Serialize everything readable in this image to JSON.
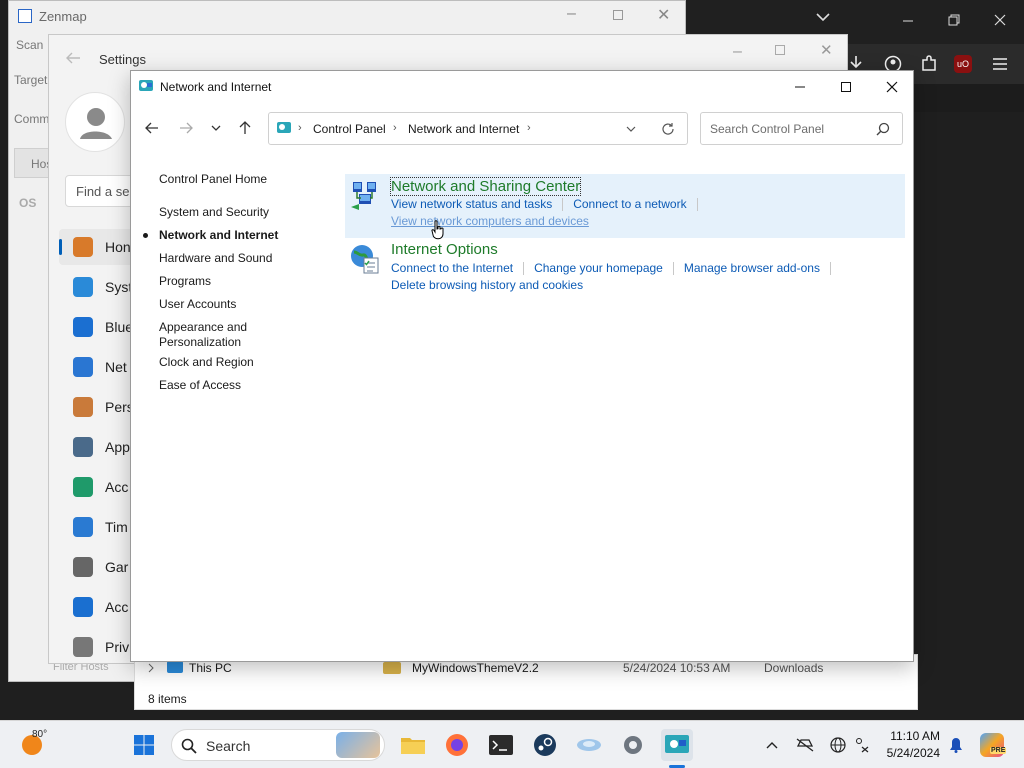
{
  "browser": {
    "icons": [
      "chevron-down-icon",
      "minimize-icon",
      "restore-icon",
      "close-icon",
      "download-icon",
      "account-icon",
      "extensions-icon",
      "ublock-icon",
      "menu-icon"
    ],
    "ublock_badge": "uO"
  },
  "zenmap": {
    "title": "Zenmap",
    "labels": {
      "scan": "Scan",
      "target": "Target",
      "command": "Comm",
      "hosts_tab": "Hos",
      "os": "OS",
      "filter_hosts": "Filter Hosts"
    }
  },
  "settings": {
    "title": "Settings",
    "search_placeholder": "Find a se",
    "nav_items": [
      {
        "label": "Hon",
        "icon": "home-icon",
        "color": "#d87a2a",
        "active": true
      },
      {
        "label": "Syst",
        "icon": "system-icon",
        "color": "#2a8ad8"
      },
      {
        "label": "Blue",
        "icon": "bluetooth-icon",
        "color": "#1b6fd1"
      },
      {
        "label": "Net",
        "icon": "wifi-icon",
        "color": "#2a76d2"
      },
      {
        "label": "Pers",
        "icon": "brush-icon",
        "color": "#c97a3a"
      },
      {
        "label": "App",
        "icon": "apps-icon",
        "color": "#4a6a8a"
      },
      {
        "label": "Acc",
        "icon": "accounts-icon",
        "color": "#1f9a6a"
      },
      {
        "label": "Tim",
        "icon": "time-language-icon",
        "color": "#2a7ad2"
      },
      {
        "label": "Gar",
        "icon": "gaming-icon",
        "color": "#666666"
      },
      {
        "label": "Acc",
        "icon": "accessibility-icon",
        "color": "#1a6fd0"
      },
      {
        "label": "Priv",
        "icon": "shield-icon",
        "color": "#777777"
      }
    ]
  },
  "explorer": {
    "tree_item": "This PC",
    "file_name": "MyWindowsThemeV2.2",
    "file_date": "5/24/2024 10:53 AM",
    "file_location": "Downloads",
    "status": "8 items"
  },
  "control_panel": {
    "title": "Network and Internet",
    "breadcrumbs": [
      "Control Panel",
      "Network and Internet"
    ],
    "search_placeholder": "Search Control Panel",
    "sidebar": {
      "home": "Control Panel Home",
      "items": [
        "System and Security",
        "Network and Internet",
        "Hardware and Sound",
        "Programs",
        "User Accounts",
        "Appearance and Personalization",
        "Clock and Region",
        "Ease of Access"
      ],
      "current": "Network and Internet"
    },
    "categories": [
      {
        "title": "Network and Sharing Center",
        "icon": "network-sharing-icon",
        "tasks": [
          "View network status and tasks",
          "Connect to a network",
          "View network computers and devices"
        ]
      },
      {
        "title": "Internet Options",
        "icon": "internet-options-icon",
        "tasks": [
          "Connect to the Internet",
          "Change your homepage",
          "Manage browser add-ons",
          "Delete browsing history and cookies"
        ]
      }
    ]
  },
  "taskbar": {
    "weather_temp": "80°",
    "search_label": "Search",
    "apps": [
      "start-icon",
      "file-explorer-icon",
      "firefox-icon",
      "terminal-icon",
      "steam-icon",
      "network-app-icon",
      "settings-icon",
      "control-panel-icon"
    ],
    "tray_icons": [
      "chevron-up-icon",
      "network-off-icon",
      "globe-icon",
      "accessibility-tray-icon",
      "notification-bell-icon",
      "copilot-icon"
    ],
    "time": "11:10 AM",
    "date": "5/24/2024",
    "copilot_badge": "PRE"
  }
}
